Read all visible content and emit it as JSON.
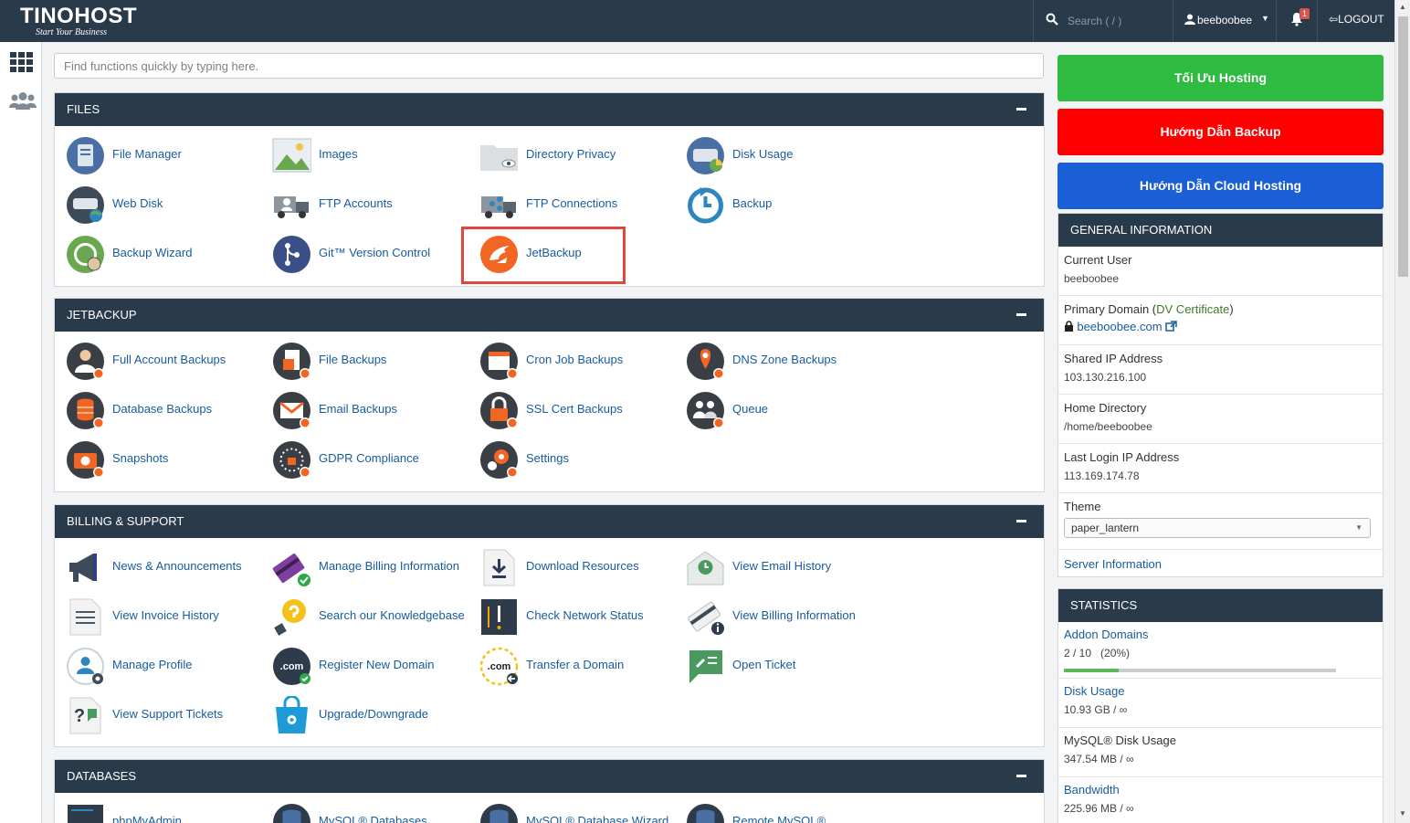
{
  "topbar": {
    "logo_text": "TINOHOST",
    "logo_tagline": "Start Your Business",
    "search_placeholder": "Search ( / )",
    "username": "beeboobee",
    "notification_count": "1",
    "logout_label": "LOGOUT"
  },
  "sidebar": {
    "items": [
      {
        "icon": "grid-icon"
      },
      {
        "icon": "users-icon"
      }
    ]
  },
  "quick_search": {
    "placeholder": "Find functions quickly by typing here."
  },
  "panels": {
    "files": {
      "title": "FILES",
      "items": [
        {
          "label": "File Manager",
          "icon": "file-manager-icon"
        },
        {
          "label": "Images",
          "icon": "images-icon"
        },
        {
          "label": "Directory Privacy",
          "icon": "directory-privacy-icon"
        },
        {
          "label": "Disk Usage",
          "icon": "disk-usage-icon"
        },
        {
          "label": "Web Disk",
          "icon": "web-disk-icon"
        },
        {
          "label": "FTP Accounts",
          "icon": "ftp-accounts-icon"
        },
        {
          "label": "FTP Connections",
          "icon": "ftp-connections-icon"
        },
        {
          "label": "Backup",
          "icon": "backup-icon"
        },
        {
          "label": "Backup Wizard",
          "icon": "backup-wizard-icon"
        },
        {
          "label": "Git™ Version Control",
          "icon": "git-icon"
        },
        {
          "label": "JetBackup",
          "icon": "jetbackup-icon"
        }
      ]
    },
    "jetbackup": {
      "title": "JETBACKUP",
      "items": [
        {
          "label": "Full Account Backups",
          "icon": "full-account-backups-icon"
        },
        {
          "label": "File Backups",
          "icon": "file-backups-icon"
        },
        {
          "label": "Cron Job Backups",
          "icon": "cron-job-backups-icon"
        },
        {
          "label": "DNS Zone Backups",
          "icon": "dns-zone-backups-icon"
        },
        {
          "label": "Database Backups",
          "icon": "database-backups-icon"
        },
        {
          "label": "Email Backups",
          "icon": "email-backups-icon"
        },
        {
          "label": "SSL Cert Backups",
          "icon": "ssl-cert-backups-icon"
        },
        {
          "label": "Queue",
          "icon": "queue-icon"
        },
        {
          "label": "Snapshots",
          "icon": "snapshots-icon"
        },
        {
          "label": "GDPR Compliance",
          "icon": "gdpr-icon"
        },
        {
          "label": "Settings",
          "icon": "settings-icon"
        }
      ]
    },
    "billing": {
      "title": "BILLING & SUPPORT",
      "items": [
        {
          "label": "News & Announcements",
          "icon": "megaphone-icon"
        },
        {
          "label": "Manage Billing Information",
          "icon": "credit-card-icon"
        },
        {
          "label": "Download Resources",
          "icon": "download-icon"
        },
        {
          "label": "View Email History",
          "icon": "email-history-icon"
        },
        {
          "label": "View Invoice History",
          "icon": "invoice-icon"
        },
        {
          "label": "Search our Knowledgebase",
          "icon": "lightbulb-icon"
        },
        {
          "label": "Check Network Status",
          "icon": "network-status-icon"
        },
        {
          "label": "View Billing Information",
          "icon": "billing-info-icon"
        },
        {
          "label": "Manage Profile",
          "icon": "profile-icon"
        },
        {
          "label": "Register New Domain",
          "icon": "register-domain-icon"
        },
        {
          "label": "Transfer a Domain",
          "icon": "transfer-domain-icon"
        },
        {
          "label": "Open Ticket",
          "icon": "open-ticket-icon"
        },
        {
          "label": "View Support Tickets",
          "icon": "support-tickets-icon"
        },
        {
          "label": "Upgrade/Downgrade",
          "icon": "upgrade-icon"
        }
      ]
    },
    "databases": {
      "title": "DATABASES",
      "items": [
        {
          "label": "phpMyAdmin",
          "icon": "phpmyadmin-icon"
        },
        {
          "label": "MySQL® Databases",
          "icon": "mysql-databases-icon"
        },
        {
          "label": "MySQL® Database Wizard",
          "icon": "mysql-wizard-icon"
        },
        {
          "label": "Remote MySQL®",
          "icon": "remote-mysql-icon"
        }
      ]
    }
  },
  "right_buttons": [
    {
      "label": "Tối Ưu Hosting",
      "color": "#2fba42"
    },
    {
      "label": "Hướng Dẫn Backup",
      "color": "#ff0000"
    },
    {
      "label": "Hướng Dẫn Cloud Hosting",
      "color": "#1b5fd6"
    }
  ],
  "general_info": {
    "title": "GENERAL INFORMATION",
    "current_user_label": "Current User",
    "current_user": "beeboobee",
    "primary_domain_label": "Primary Domain",
    "cert_label": "DV Certificate",
    "primary_domain": "beeboobee.com",
    "shared_ip_label": "Shared IP Address",
    "shared_ip": "103.130.216.100",
    "home_dir_label": "Home Directory",
    "home_dir": "/home/beeboobee",
    "last_login_label": "Last Login IP Address",
    "last_login_ip": "113.169.174.78",
    "theme_label": "Theme",
    "theme_value": "paper_lantern",
    "server_info_link": "Server Information"
  },
  "statistics": {
    "title": "STATISTICS",
    "addon_domains_label": "Addon Domains",
    "addon_domains_value": "2 / 10   (20%)",
    "addon_domains_fraction": 0.2,
    "disk_usage_label": "Disk Usage",
    "disk_usage_value": "10.93 GB / ∞",
    "mysql_label": "MySQL® Disk Usage",
    "mysql_value": "347.54 MB / ∞",
    "bandwidth_label": "Bandwidth",
    "bandwidth_value": "225.96 MB / ∞"
  }
}
